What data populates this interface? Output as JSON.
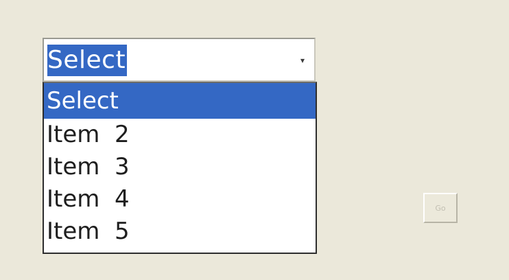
{
  "dropdown": {
    "value": "Select",
    "arrow_icon": "▾",
    "options": [
      {
        "label": "Select",
        "selected": true
      },
      {
        "label": "Item  2",
        "selected": false
      },
      {
        "label": "Item  3",
        "selected": false
      },
      {
        "label": "Item  4",
        "selected": false
      },
      {
        "label": "Item  5",
        "selected": false
      }
    ]
  },
  "go_button": {
    "label": "Go",
    "disabled": true
  },
  "colors": {
    "background": "#ebe8da",
    "highlight": "#3468c4",
    "highlight_text": "#ffffff",
    "disabled_text": "#c2bfb2"
  }
}
